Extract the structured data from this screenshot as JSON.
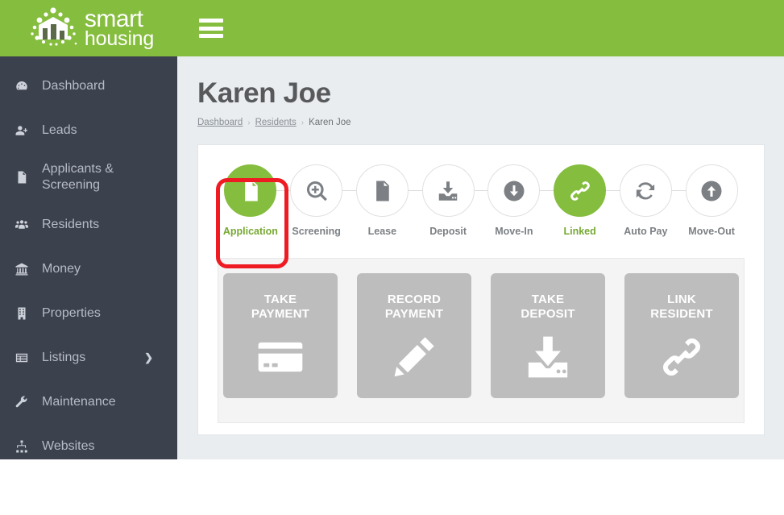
{
  "brand": {
    "line1": "smart",
    "line2": "housing",
    "logo_icon": "buildings-dots-logo"
  },
  "topbar": {
    "menu_icon": "hamburger-menu-icon",
    "bg_color": "#85bd3e"
  },
  "sidebar": {
    "bg_color": "#3c414e",
    "items": [
      {
        "label": "Dashboard",
        "icon": "dashboard-gauge-icon",
        "has_caret": false
      },
      {
        "label": "Leads",
        "icon": "user-plus-icon",
        "has_caret": false
      },
      {
        "label": "Applicants & Screening",
        "icon": "document-icon",
        "has_caret": false
      },
      {
        "label": "Residents",
        "icon": "users-group-icon",
        "has_caret": false
      },
      {
        "label": "Money",
        "icon": "bank-icon",
        "has_caret": false
      },
      {
        "label": "Properties",
        "icon": "building-icon",
        "has_caret": false
      },
      {
        "label": "Listings",
        "icon": "list-window-icon",
        "has_caret": true
      },
      {
        "label": "Maintenance",
        "icon": "wrench-icon",
        "has_caret": false
      },
      {
        "label": "Websites",
        "icon": "sitemap-icon",
        "has_caret": false
      }
    ]
  },
  "page": {
    "title": "Karen Joe",
    "breadcrumb": [
      {
        "label": "Dashboard",
        "link": true
      },
      {
        "label": "Residents",
        "link": true
      },
      {
        "label": "Karen Joe",
        "link": false
      }
    ]
  },
  "stepper": {
    "active_color": "#85bd3e",
    "inactive_color": "#7c8084",
    "steps": [
      {
        "label": "Application",
        "icon": "document-lines-icon",
        "active": true
      },
      {
        "label": "Screening",
        "icon": "magnifier-plus-icon",
        "active": false
      },
      {
        "label": "Lease",
        "icon": "document-lines-icon",
        "active": false
      },
      {
        "label": "Deposit",
        "icon": "download-tray-icon",
        "active": false
      },
      {
        "label": "Move-In",
        "icon": "arrow-down-circle-icon",
        "active": false
      },
      {
        "label": "Linked",
        "icon": "chain-link-icon",
        "active": true
      },
      {
        "label": "Auto Pay",
        "icon": "refresh-cycle-icon",
        "active": false
      },
      {
        "label": "Move-Out",
        "icon": "arrow-up-circle-icon",
        "active": false
      }
    ]
  },
  "tiles": [
    {
      "line1": "TAKE",
      "line2": "PAYMENT",
      "icon": "credit-card-icon"
    },
    {
      "line1": "RECORD",
      "line2": "PAYMENT",
      "icon": "pencil-icon"
    },
    {
      "line1": "TAKE",
      "line2": "DEPOSIT",
      "icon": "download-tray-icon"
    },
    {
      "line1": "LINK",
      "line2": "RESIDENT",
      "icon": "chain-link-icon"
    }
  ],
  "annotation": {
    "shape": "rounded-rectangle",
    "color": "#ee1b23",
    "target": "Application"
  }
}
